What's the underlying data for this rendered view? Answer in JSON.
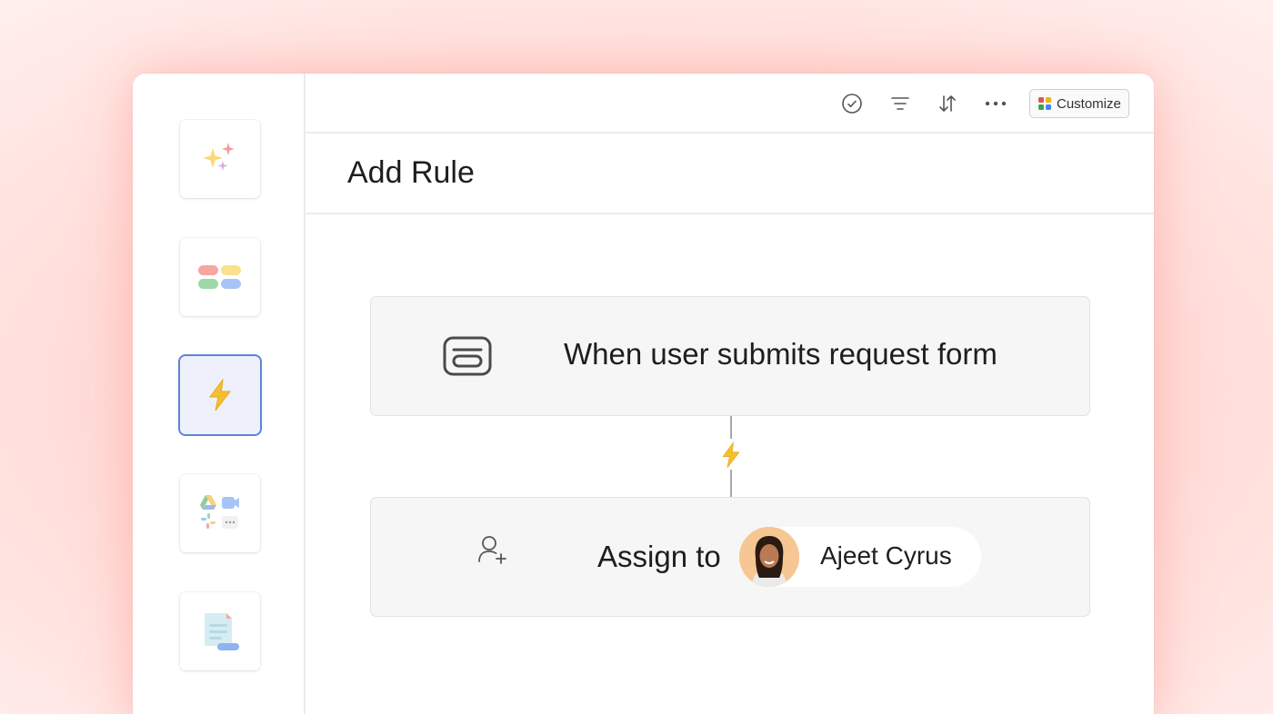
{
  "toolbar": {
    "icons": [
      "check-circle-icon",
      "filter-lines-icon",
      "sort-arrows-icon",
      "more-dots-icon"
    ],
    "customize_label": "Customize",
    "customize_grid_colors": [
      "#e2574c",
      "#f4b400",
      "#34a853",
      "#4285f4"
    ]
  },
  "sidebar": {
    "items": [
      {
        "name": "sparkles-icon",
        "active": false
      },
      {
        "name": "color-blocks-icon",
        "active": false
      },
      {
        "name": "lightning-bolt-icon",
        "active": true
      },
      {
        "name": "integrations-icon",
        "active": false
      },
      {
        "name": "form-document-icon",
        "active": false
      }
    ]
  },
  "page": {
    "title": "Add Rule"
  },
  "rule": {
    "trigger": {
      "icon": "form-icon",
      "text": "When user submits request form"
    },
    "connector_icon": "lightning-bolt-icon",
    "action": {
      "icon": "add-user-icon",
      "text": "Assign to",
      "assignee_name": "Ajeet Cyrus"
    }
  },
  "colors": {
    "bolt": "#f4c02f",
    "active_border": "#5b85d8",
    "active_bg": "#eef0fb",
    "background_pink": "#ffd7d3"
  }
}
